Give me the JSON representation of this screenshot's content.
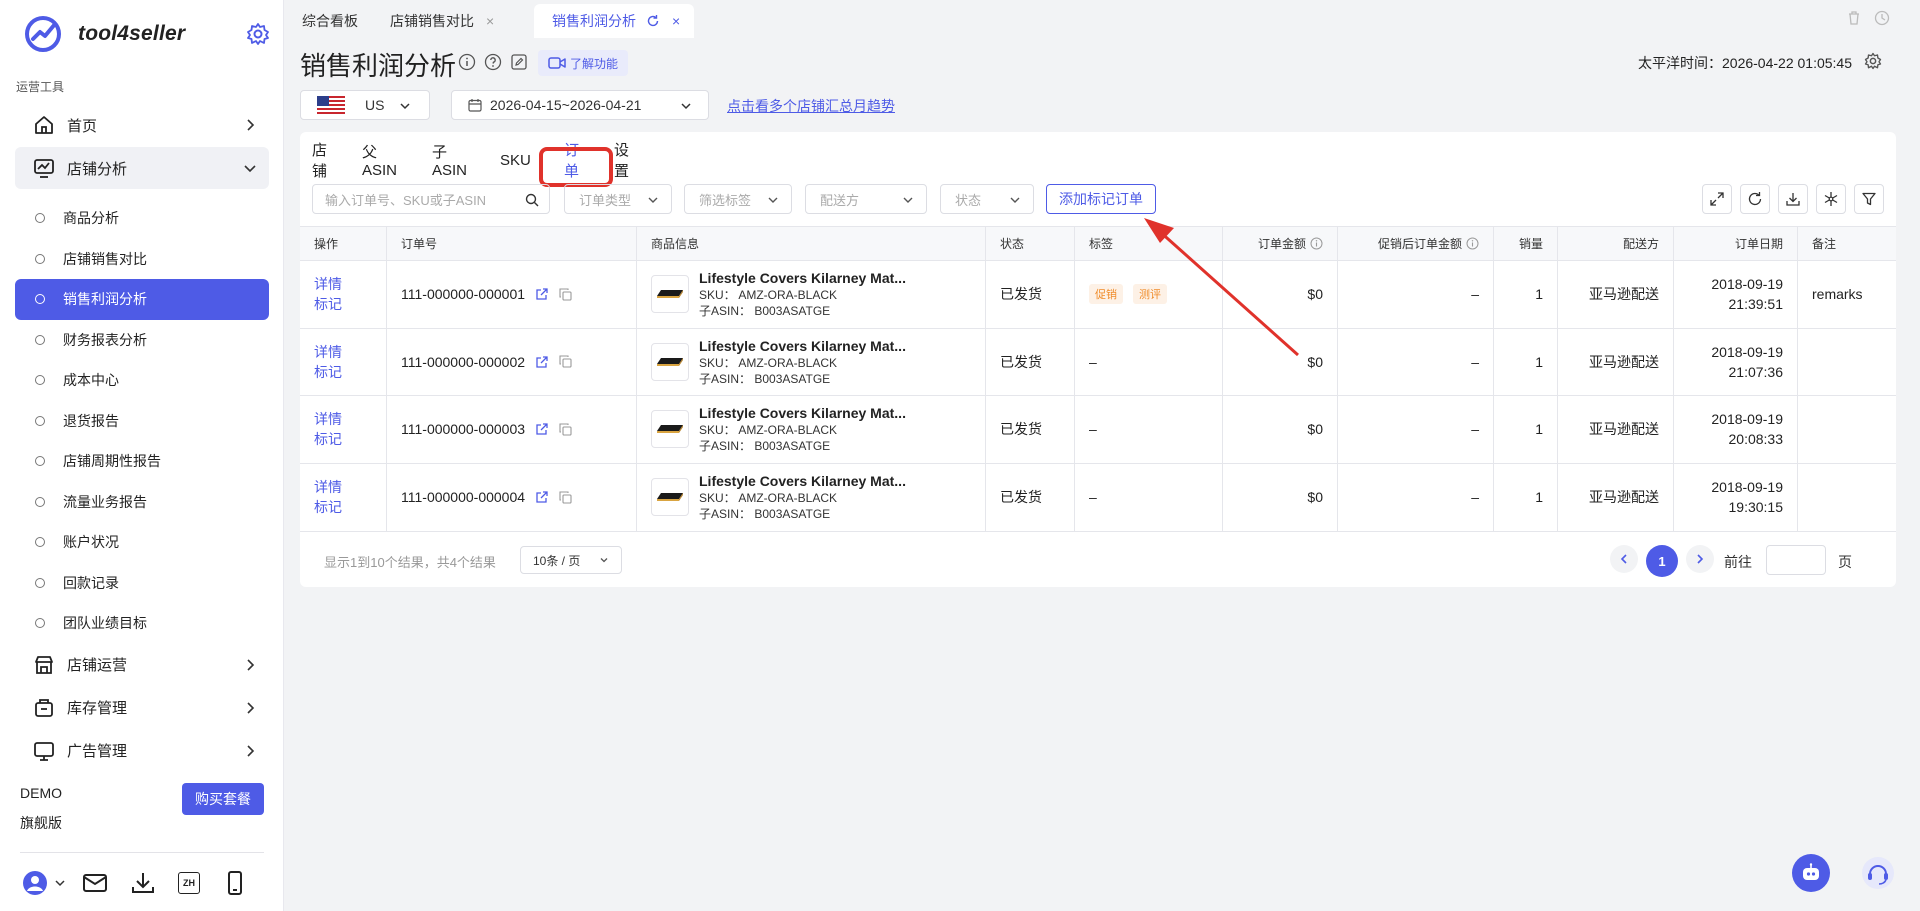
{
  "app": {
    "name": "tool4seller",
    "section_label": "运营工具"
  },
  "sidebar": {
    "top_items": [
      {
        "label": "首页"
      },
      {
        "label": "店铺分析"
      }
    ],
    "sub_items": [
      {
        "label": "商品分析"
      },
      {
        "label": "店铺销售对比"
      },
      {
        "label": "销售利润分析"
      },
      {
        "label": "财务报表分析"
      },
      {
        "label": "成本中心"
      },
      {
        "label": "退货报告"
      },
      {
        "label": "店铺周期性报告"
      },
      {
        "label": "流量业务报告"
      },
      {
        "label": "账户状况"
      },
      {
        "label": "回款记录"
      },
      {
        "label": "团队业绩目标"
      }
    ],
    "bottom_items": [
      {
        "label": "店铺运营"
      },
      {
        "label": "库存管理"
      },
      {
        "label": "广告管理"
      }
    ],
    "account": {
      "name": "DEMO",
      "edition": "旗舰版",
      "buy_label": "购买套餐"
    },
    "footer_lang": "ZH"
  },
  "tabs": [
    {
      "label": "综合看板"
    },
    {
      "label": "店铺销售对比",
      "close": "×"
    },
    {
      "label": "销售利润分析",
      "close": "×"
    }
  ],
  "header": {
    "title": "销售利润分析",
    "learn_label": "了解功能",
    "timezone_label": "太平洋时间：2026-04-22 01:05:45"
  },
  "controls": {
    "country": "US",
    "date_range": "2026-04-15~2026-04-21",
    "trend_link": "点击看多个店铺汇总月趋势"
  },
  "subtabs": [
    "店铺",
    "父ASIN",
    "子ASIN",
    "SKU",
    "订单",
    "设置"
  ],
  "filters": {
    "search_placeholder": "输入订单号、SKU或子ASIN",
    "order_type": "订单类型",
    "tag_filter": "筛选标签",
    "fulfillment": "配送方",
    "status": "状态",
    "add_mark_label": "添加标记订单"
  },
  "table": {
    "headers": [
      "操作",
      "订单号",
      "商品信息",
      "状态",
      "标签",
      "订单金额",
      "促销后订单金额",
      "销量",
      "配送方",
      "订单日期",
      "备注"
    ],
    "op_detail": "详情",
    "op_mark": "标记",
    "rows": [
      {
        "order": "111-000000-000001",
        "name": "Lifestyle Covers Kilarney Mat...",
        "sku": "SKU：  AMZ-ORA-BLACK",
        "asin": "子ASIN：  B003ASATGE",
        "status": "已发货",
        "tags": [
          "促销",
          "测评"
        ],
        "amount": "$0",
        "promo_amount": "–",
        "qty": "1",
        "fulfillment": "亚马逊配送",
        "date": "2018-09-19",
        "time": "21:39:51",
        "remark": "remarks"
      },
      {
        "order": "111-000000-000002",
        "name": "Lifestyle Covers Kilarney Mat...",
        "sku": "SKU：  AMZ-ORA-BLACK",
        "asin": "子ASIN：  B003ASATGE",
        "status": "已发货",
        "tag_text": "–",
        "amount": "$0",
        "promo_amount": "–",
        "qty": "1",
        "fulfillment": "亚马逊配送",
        "date": "2018-09-19",
        "time": "21:07:36",
        "remark": ""
      },
      {
        "order": "111-000000-000003",
        "name": "Lifestyle Covers Kilarney Mat...",
        "sku": "SKU：  AMZ-ORA-BLACK",
        "asin": "子ASIN：  B003ASATGE",
        "status": "已发货",
        "tag_text": "–",
        "amount": "$0",
        "promo_amount": "–",
        "qty": "1",
        "fulfillment": "亚马逊配送",
        "date": "2018-09-19",
        "time": "20:08:33",
        "remark": ""
      },
      {
        "order": "111-000000-000004",
        "name": "Lifestyle Covers Kilarney Mat...",
        "sku": "SKU：  AMZ-ORA-BLACK",
        "asin": "子ASIN：  B003ASATGE",
        "status": "已发货",
        "tag_text": "–",
        "amount": "$0",
        "promo_amount": "–",
        "qty": "1",
        "fulfillment": "亚马逊配送",
        "date": "2018-09-19",
        "time": "19:30:15",
        "remark": ""
      }
    ]
  },
  "pagination": {
    "summary": "显示1到10个结果，共4个结果",
    "page_size": "10条 / 页",
    "current": "1",
    "goto_label": "前往",
    "page_suffix": "页"
  },
  "colors": {
    "accent": "#4e5be6",
    "highlight": "#e0322b",
    "tag": "#f08c2a"
  }
}
